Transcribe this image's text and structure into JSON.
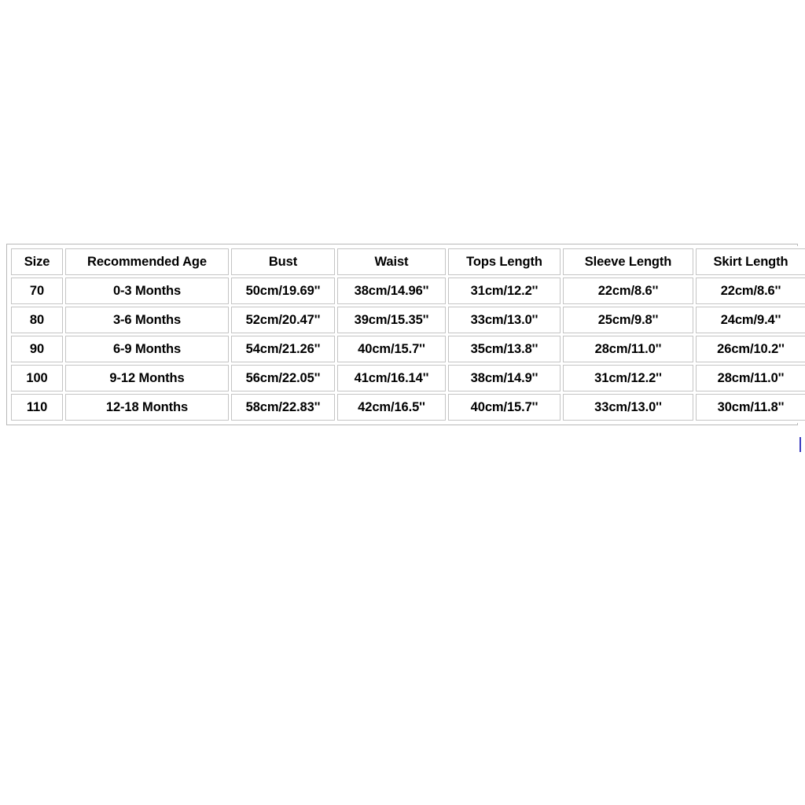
{
  "page": {
    "background_color": "#ffffff",
    "border_color": "#c4c4c4",
    "text_color": "#000000"
  },
  "cursor": {
    "name": "text-cursor-artifact",
    "color": "#3b3bbf"
  },
  "size_chart": {
    "columns": [
      "Size",
      "Recommended Age",
      "Bust",
      "Waist",
      "Tops Length",
      "Sleeve Length",
      "Skirt Length"
    ],
    "rows": [
      {
        "size": "70",
        "age": "0-3 Months",
        "bust": "50cm/19.69''",
        "waist": "38cm/14.96''",
        "tops_length": "31cm/12.2''",
        "sleeve_length": "22cm/8.6''",
        "skirt_length": "22cm/8.6''"
      },
      {
        "size": "80",
        "age": "3-6 Months",
        "bust": "52cm/20.47''",
        "waist": "39cm/15.35''",
        "tops_length": "33cm/13.0''",
        "sleeve_length": "25cm/9.8''",
        "skirt_length": "24cm/9.4''"
      },
      {
        "size": "90",
        "age": "6-9 Months",
        "bust": "54cm/21.26''",
        "waist": "40cm/15.7''",
        "tops_length": "35cm/13.8''",
        "sleeve_length": "28cm/11.0''",
        "skirt_length": "26cm/10.2''"
      },
      {
        "size": "100",
        "age": "9-12 Months",
        "bust": "56cm/22.05''",
        "waist": "41cm/16.14''",
        "tops_length": "38cm/14.9''",
        "sleeve_length": "31cm/12.2''",
        "skirt_length": "28cm/11.0''"
      },
      {
        "size": "110",
        "age": "12-18 Months",
        "bust": "58cm/22.83''",
        "waist": "42cm/16.5''",
        "tops_length": "40cm/15.7''",
        "sleeve_length": "33cm/13.0''",
        "skirt_length": "30cm/11.8''"
      }
    ]
  }
}
